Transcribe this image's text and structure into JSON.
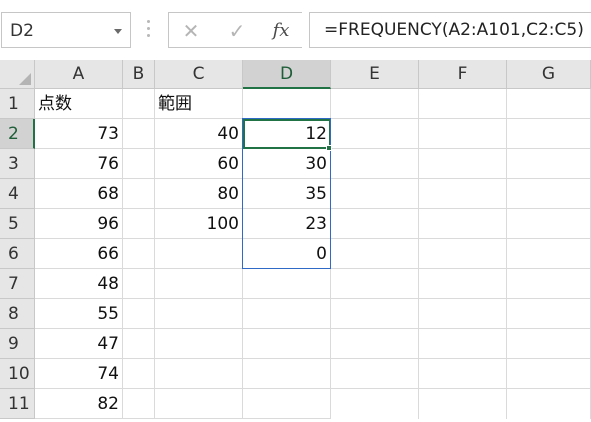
{
  "name_box": {
    "value": "D2"
  },
  "formula_bar": {
    "cancel_icon": "cancel-x",
    "enter_icon": "check-mark",
    "function_label": "fx",
    "formula": "=FREQUENCY(A2:A101,C2:C5)"
  },
  "columns": [
    "A",
    "B",
    "C",
    "D",
    "E",
    "F",
    "G"
  ],
  "selected_column": "D",
  "rows": [
    "1",
    "2",
    "3",
    "4",
    "5",
    "6",
    "7",
    "8",
    "9",
    "10",
    "11"
  ],
  "selected_row": "2",
  "cells": {
    "A": [
      "点数",
      "73",
      "76",
      "68",
      "96",
      "66",
      "48",
      "55",
      "47",
      "74",
      "82"
    ],
    "C": [
      "範囲",
      "40",
      "60",
      "80",
      "100",
      "",
      "",
      "",
      "",
      "",
      ""
    ],
    "D": [
      "",
      "12",
      "30",
      "35",
      "23",
      "0",
      "",
      "",
      "",
      "",
      ""
    ]
  },
  "colors": {
    "accent": "#217346",
    "range_border": "#2f6ac7",
    "header_bg": "#e6e6e6"
  }
}
